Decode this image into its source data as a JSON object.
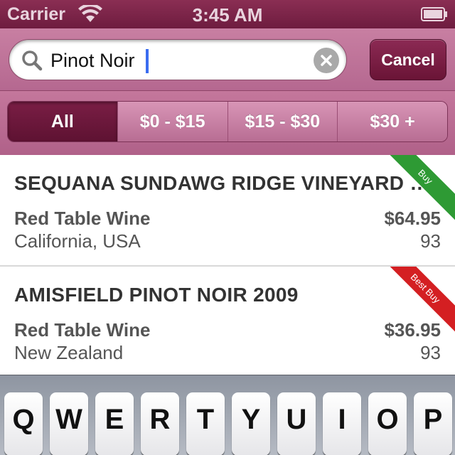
{
  "status_bar": {
    "carrier": "Carrier",
    "time": "3:45 AM"
  },
  "search": {
    "value": "Pinot Noir",
    "cancel_label": "Cancel"
  },
  "filters": [
    {
      "label": "All",
      "selected": true
    },
    {
      "label": "$0 - $15",
      "selected": false
    },
    {
      "label": "$15 - $30",
      "selected": false
    },
    {
      "label": "$30 +",
      "selected": false
    }
  ],
  "results": [
    {
      "name": "SEQUANA SUNDAWG RIDGE VINEYARD PINOT NOIR",
      "type": "Red Table Wine",
      "region": "California, USA",
      "price": "$64.95",
      "score": "93",
      "badge": "Buy",
      "badge_color": "#2e9a34"
    },
    {
      "name": "AMISFIELD PINOT NOIR 2009",
      "type": "Red Table Wine",
      "region": "New Zealand",
      "price": "$36.95",
      "score": "93",
      "badge": "Best Buy",
      "badge_color": "#d41f22"
    }
  ],
  "keyboard": {
    "row1": [
      "Q",
      "W",
      "E",
      "R",
      "T",
      "Y",
      "U",
      "I",
      "O",
      "P"
    ]
  },
  "colors": {
    "brand": "#6e1c3f",
    "accent": "#b56890"
  }
}
